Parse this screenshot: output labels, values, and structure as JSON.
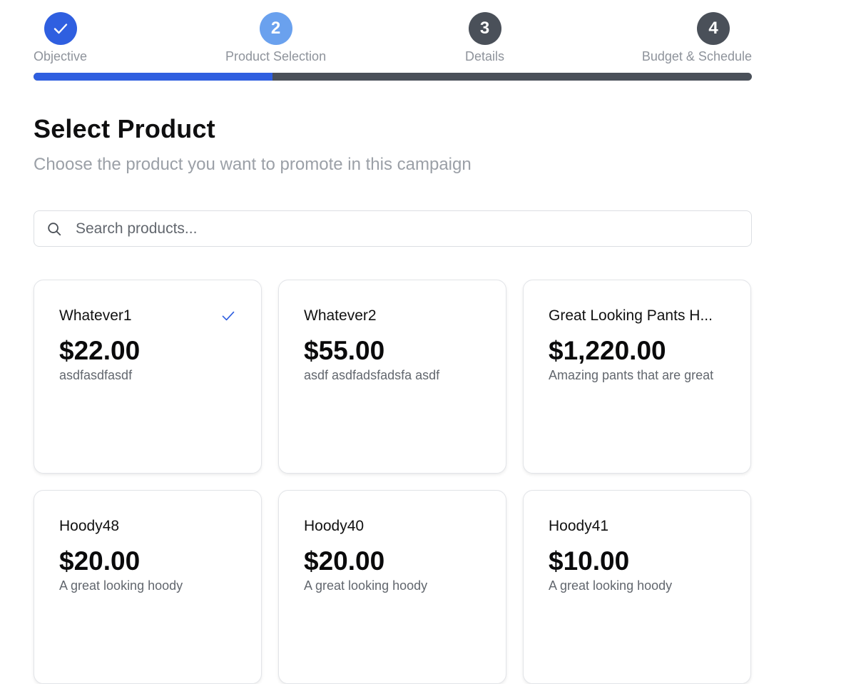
{
  "stepper": {
    "progress_fraction": 0.333,
    "steps": [
      {
        "number": "1",
        "label": "Objective",
        "state": "done",
        "icon": "check-icon"
      },
      {
        "number": "2",
        "label": "Product Selection",
        "state": "current"
      },
      {
        "number": "3",
        "label": "Details",
        "state": "upcoming"
      },
      {
        "number": "4",
        "label": "Budget & Schedule",
        "state": "upcoming"
      }
    ]
  },
  "header": {
    "title": "Select Product",
    "subtitle": "Choose the product you want to promote in this campaign"
  },
  "search": {
    "placeholder": "Search products...",
    "value": "",
    "icon": "search-icon"
  },
  "products": [
    {
      "name": "Whatever1",
      "price": "$22.00",
      "description": "asdfasdfasdf",
      "selected": true
    },
    {
      "name": "Whatever2",
      "price": "$55.00",
      "description": "asdf asdfadsfadsfa asdf",
      "selected": false
    },
    {
      "name": "Great Looking Pants H...",
      "price": "$1,220.00",
      "description": "Amazing pants that are great",
      "selected": false
    },
    {
      "name": "Hoody48",
      "price": "$20.00",
      "description": "A great looking hoody",
      "selected": false
    },
    {
      "name": "Hoody40",
      "price": "$20.00",
      "description": "A great looking hoody",
      "selected": false
    },
    {
      "name": "Hoody41",
      "price": "$10.00",
      "description": "A great looking hoody",
      "selected": false
    }
  ],
  "colors": {
    "accent": "#2f5fe0",
    "current_step": "#6aa1ee",
    "upcoming_step": "#4a5059",
    "muted_text": "#9ba0a7"
  }
}
